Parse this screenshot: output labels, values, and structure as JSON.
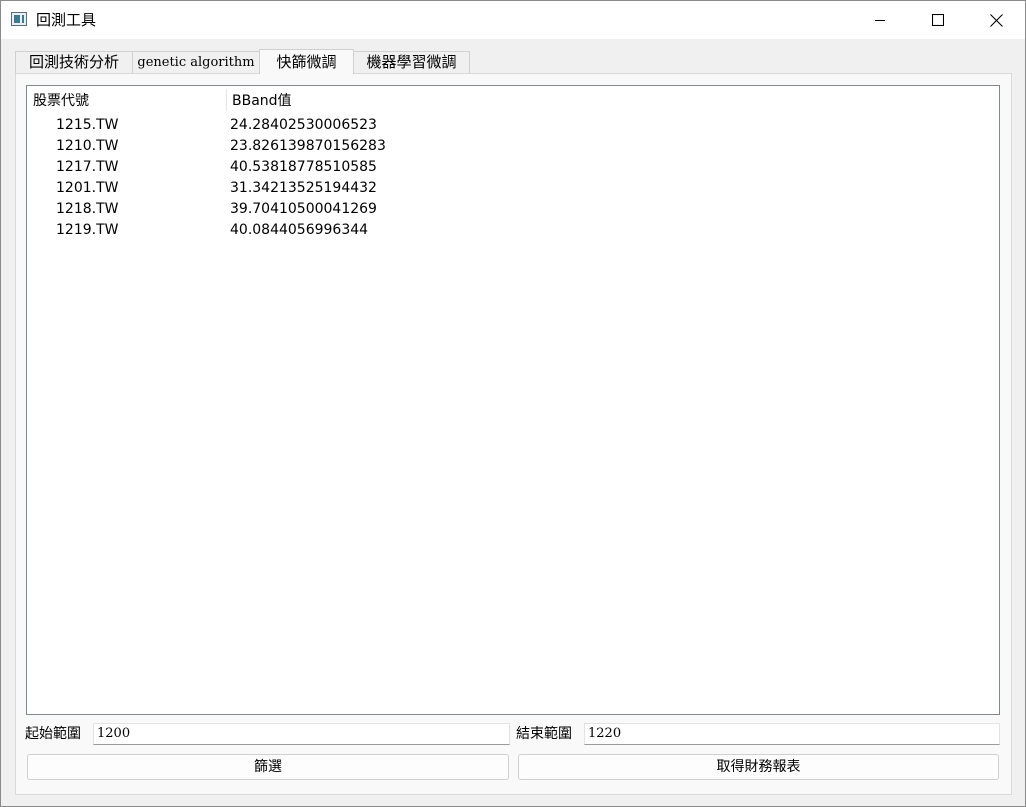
{
  "window": {
    "title": "回測工具"
  },
  "tabs": [
    {
      "label": "回測技術分析",
      "active": false
    },
    {
      "label": "genetic algorithm",
      "active": false
    },
    {
      "label": "快篩微調",
      "active": true
    },
    {
      "label": "機器學習微調",
      "active": false
    }
  ],
  "table": {
    "headers": [
      "股票代號",
      "BBand值"
    ],
    "rows": [
      {
        "code": "1215.TW",
        "value": "24.28402530006523"
      },
      {
        "code": "1210.TW",
        "value": "23.826139870156283"
      },
      {
        "code": "1217.TW",
        "value": "40.53818778510585"
      },
      {
        "code": "1201.TW",
        "value": "31.34213525194432"
      },
      {
        "code": "1218.TW",
        "value": "39.70410500041269"
      },
      {
        "code": "1219.TW",
        "value": "40.0844056996344"
      }
    ]
  },
  "filters": {
    "start_label": "起始範圍",
    "start_value": "1200",
    "end_label": "結束範圍",
    "end_value": "1220"
  },
  "buttons": {
    "filter_label": "篩選",
    "financials_label": "取得財務報表"
  },
  "icons": {
    "app": "app-window-icon",
    "minimize": "minimize-icon",
    "maximize": "maximize-icon",
    "close": "close-icon"
  }
}
